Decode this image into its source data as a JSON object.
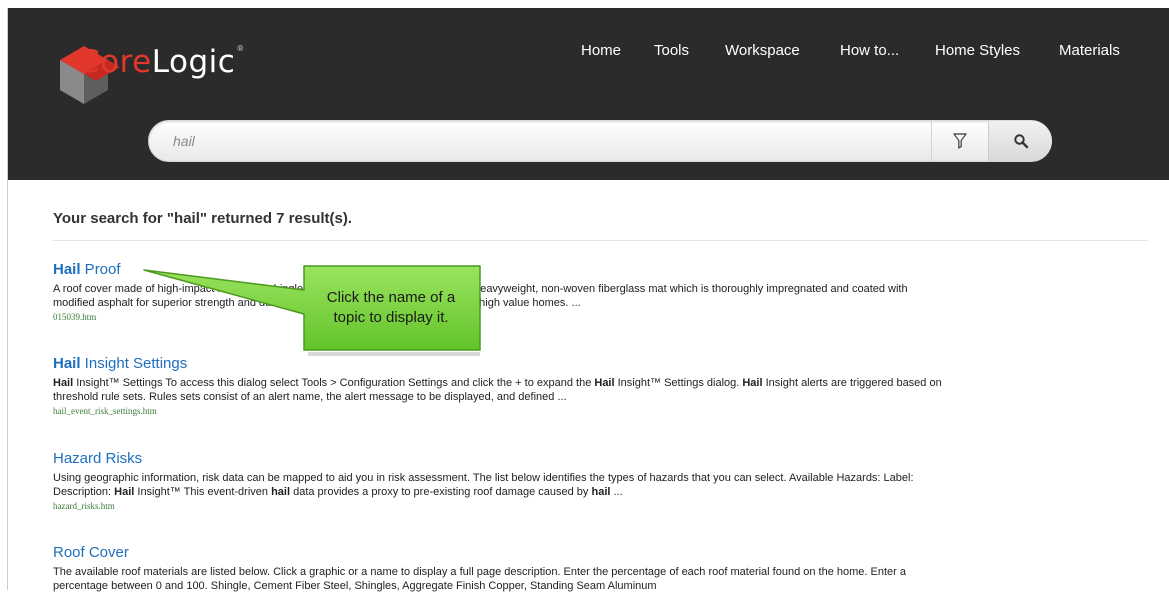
{
  "header": {
    "logo": {
      "word_part1": "Core",
      "word_part2": "Logic",
      "trademark": "®"
    },
    "nav": [
      {
        "label": "Home"
      },
      {
        "label": "Tools"
      },
      {
        "label": "Workspace"
      },
      {
        "label": "How to..."
      },
      {
        "label": "Home Styles"
      },
      {
        "label": "Materials"
      }
    ],
    "search": {
      "value": "hail",
      "filter_icon": "funnel-icon",
      "search_icon": "magnifier-icon"
    }
  },
  "results_summary": "Your search for \"hail\" returned 7 result(s).",
  "results": [
    {
      "title_bold": "Hail",
      "title_rest": " Proof",
      "desc_line1": "A roof cover made of high-impact laminated shingles. The shingles are composed of a heavyweight, non-woven fiberglass mat which is thoroughly impregnated and coated with",
      "desc_line2": "modified asphalt for superior strength and durability in the colors and patterns typical of high value homes. ...",
      "file": "015039.htm"
    },
    {
      "title_bold": "Hail",
      "title_rest": " Insight Settings",
      "desc_line1_segments": [
        {
          "text": "Hail",
          "bold": true
        },
        {
          "text": " Insight™ Settings To access this dialog select Tools > Configuration Settings and click the + to expand the ",
          "bold": false
        },
        {
          "text": "Hail",
          "bold": true
        },
        {
          "text": " Insight™ Settings dialog. ",
          "bold": false
        },
        {
          "text": "Hail",
          "bold": true
        },
        {
          "text": " Insight alerts are triggered based on",
          "bold": false
        }
      ],
      "desc_line2": "threshold rule sets. Rules sets consist of an alert name, the alert message to be displayed, and defined ...",
      "file": "hail_event_risk_settings.htm"
    },
    {
      "title_bold": "",
      "title_rest": "Hazard Risks",
      "desc_line1": "Using geographic information, risk data can be mapped to aid you in risk assessment. The list below identifies the types of hazards that you can select. Available Hazards: Label:",
      "desc_line2_segments": [
        {
          "text": "Description: ",
          "bold": false
        },
        {
          "text": "Hail",
          "bold": true
        },
        {
          "text": " Insight™ This event-driven ",
          "bold": false
        },
        {
          "text": "hail",
          "bold": true
        },
        {
          "text": " data provides a proxy to pre-existing roof damage caused by ",
          "bold": false
        },
        {
          "text": "hail",
          "bold": true
        },
        {
          "text": " ...",
          "bold": false
        }
      ],
      "file": "hazard_risks.htm"
    },
    {
      "title_bold": "",
      "title_rest": "Roof Cover",
      "desc_line1": "The available roof materials are listed below. Click a graphic or a name to display a full page description. Enter the percentage of each roof material found on the home. Enter a",
      "desc_line2": "percentage between 0 and 100. Shingle, Cement Fiber Steel, Shingles, Aggregate Finish Copper, Standing Seam Aluminum"
    }
  ],
  "callout": {
    "line1": "Click the name of a",
    "line2": "topic to display it.",
    "fill_color": "#7bd83c",
    "border_color": "#4b9a1e"
  }
}
